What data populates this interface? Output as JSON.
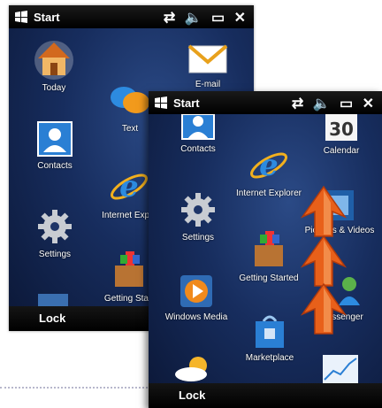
{
  "back_phone": {
    "title": "Start",
    "status_icons": "⇄ 🔈 ▭ ✕",
    "softkey": "Lock",
    "tiles": {
      "today": "Today",
      "email": "E-mail",
      "text": "Text",
      "contacts": "Contacts",
      "internet_explorer": "Internet Explo",
      "settings": "Settings",
      "getting_started": "Getting Start"
    }
  },
  "front_phone": {
    "title": "Start",
    "status_icons": "⇄ 🔈 ▭ ✕",
    "softkey": "Lock",
    "calendar_day": "30",
    "tiles": {
      "contacts": "Contacts",
      "calendar": "Calendar",
      "internet_explorer": "Internet Explorer",
      "settings": "Settings",
      "pictures_videos": "Pictures & Videos",
      "getting_started": "Getting Started",
      "windows_media": "Windows Media",
      "messenger": "ssenger",
      "marketplace": "Marketplace"
    }
  },
  "colors": {
    "arrow": "#e8601a",
    "background_dark": "#0b1736",
    "background_light": "#2b4a86"
  }
}
